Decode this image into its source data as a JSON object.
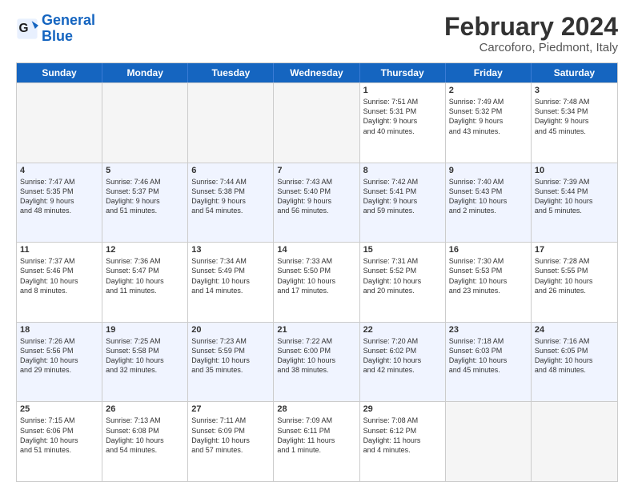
{
  "logo": {
    "text_general": "General",
    "text_blue": "Blue"
  },
  "header": {
    "title": "February 2024",
    "subtitle": "Carcoforo, Piedmont, Italy"
  },
  "weekdays": [
    "Sunday",
    "Monday",
    "Tuesday",
    "Wednesday",
    "Thursday",
    "Friday",
    "Saturday"
  ],
  "rows": [
    [
      {
        "day": "",
        "info": ""
      },
      {
        "day": "",
        "info": ""
      },
      {
        "day": "",
        "info": ""
      },
      {
        "day": "",
        "info": ""
      },
      {
        "day": "1",
        "info": "Sunrise: 7:51 AM\nSunset: 5:31 PM\nDaylight: 9 hours\nand 40 minutes."
      },
      {
        "day": "2",
        "info": "Sunrise: 7:49 AM\nSunset: 5:32 PM\nDaylight: 9 hours\nand 43 minutes."
      },
      {
        "day": "3",
        "info": "Sunrise: 7:48 AM\nSunset: 5:34 PM\nDaylight: 9 hours\nand 45 minutes."
      }
    ],
    [
      {
        "day": "4",
        "info": "Sunrise: 7:47 AM\nSunset: 5:35 PM\nDaylight: 9 hours\nand 48 minutes."
      },
      {
        "day": "5",
        "info": "Sunrise: 7:46 AM\nSunset: 5:37 PM\nDaylight: 9 hours\nand 51 minutes."
      },
      {
        "day": "6",
        "info": "Sunrise: 7:44 AM\nSunset: 5:38 PM\nDaylight: 9 hours\nand 54 minutes."
      },
      {
        "day": "7",
        "info": "Sunrise: 7:43 AM\nSunset: 5:40 PM\nDaylight: 9 hours\nand 56 minutes."
      },
      {
        "day": "8",
        "info": "Sunrise: 7:42 AM\nSunset: 5:41 PM\nDaylight: 9 hours\nand 59 minutes."
      },
      {
        "day": "9",
        "info": "Sunrise: 7:40 AM\nSunset: 5:43 PM\nDaylight: 10 hours\nand 2 minutes."
      },
      {
        "day": "10",
        "info": "Sunrise: 7:39 AM\nSunset: 5:44 PM\nDaylight: 10 hours\nand 5 minutes."
      }
    ],
    [
      {
        "day": "11",
        "info": "Sunrise: 7:37 AM\nSunset: 5:46 PM\nDaylight: 10 hours\nand 8 minutes."
      },
      {
        "day": "12",
        "info": "Sunrise: 7:36 AM\nSunset: 5:47 PM\nDaylight: 10 hours\nand 11 minutes."
      },
      {
        "day": "13",
        "info": "Sunrise: 7:34 AM\nSunset: 5:49 PM\nDaylight: 10 hours\nand 14 minutes."
      },
      {
        "day": "14",
        "info": "Sunrise: 7:33 AM\nSunset: 5:50 PM\nDaylight: 10 hours\nand 17 minutes."
      },
      {
        "day": "15",
        "info": "Sunrise: 7:31 AM\nSunset: 5:52 PM\nDaylight: 10 hours\nand 20 minutes."
      },
      {
        "day": "16",
        "info": "Sunrise: 7:30 AM\nSunset: 5:53 PM\nDaylight: 10 hours\nand 23 minutes."
      },
      {
        "day": "17",
        "info": "Sunrise: 7:28 AM\nSunset: 5:55 PM\nDaylight: 10 hours\nand 26 minutes."
      }
    ],
    [
      {
        "day": "18",
        "info": "Sunrise: 7:26 AM\nSunset: 5:56 PM\nDaylight: 10 hours\nand 29 minutes."
      },
      {
        "day": "19",
        "info": "Sunrise: 7:25 AM\nSunset: 5:58 PM\nDaylight: 10 hours\nand 32 minutes."
      },
      {
        "day": "20",
        "info": "Sunrise: 7:23 AM\nSunset: 5:59 PM\nDaylight: 10 hours\nand 35 minutes."
      },
      {
        "day": "21",
        "info": "Sunrise: 7:22 AM\nSunset: 6:00 PM\nDaylight: 10 hours\nand 38 minutes."
      },
      {
        "day": "22",
        "info": "Sunrise: 7:20 AM\nSunset: 6:02 PM\nDaylight: 10 hours\nand 42 minutes."
      },
      {
        "day": "23",
        "info": "Sunrise: 7:18 AM\nSunset: 6:03 PM\nDaylight: 10 hours\nand 45 minutes."
      },
      {
        "day": "24",
        "info": "Sunrise: 7:16 AM\nSunset: 6:05 PM\nDaylight: 10 hours\nand 48 minutes."
      }
    ],
    [
      {
        "day": "25",
        "info": "Sunrise: 7:15 AM\nSunset: 6:06 PM\nDaylight: 10 hours\nand 51 minutes."
      },
      {
        "day": "26",
        "info": "Sunrise: 7:13 AM\nSunset: 6:08 PM\nDaylight: 10 hours\nand 54 minutes."
      },
      {
        "day": "27",
        "info": "Sunrise: 7:11 AM\nSunset: 6:09 PM\nDaylight: 10 hours\nand 57 minutes."
      },
      {
        "day": "28",
        "info": "Sunrise: 7:09 AM\nSunset: 6:11 PM\nDaylight: 11 hours\nand 1 minute."
      },
      {
        "day": "29",
        "info": "Sunrise: 7:08 AM\nSunset: 6:12 PM\nDaylight: 11 hours\nand 4 minutes."
      },
      {
        "day": "",
        "info": ""
      },
      {
        "day": "",
        "info": ""
      }
    ]
  ]
}
